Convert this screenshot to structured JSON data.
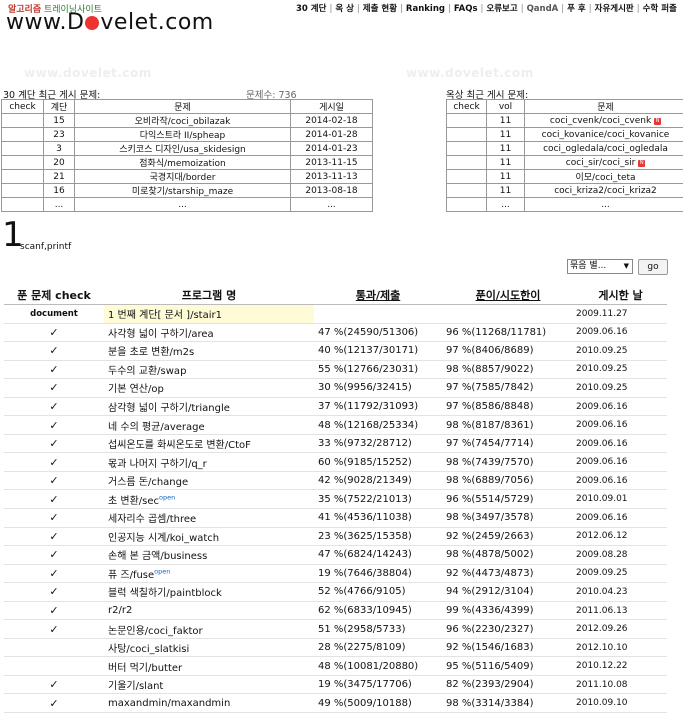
{
  "header": {
    "tagline_a": "알고리즘",
    "tagline_b": " 트레이닝사이트",
    "logo_a": "www.D",
    "logo_b": "velet.com"
  },
  "topnav": [
    "30 계단",
    "옥 상",
    "제출 현황",
    "Ranking",
    "FAQs",
    "오류보고",
    "QandA",
    "푸 후",
    "자유게시판",
    "수학 퍼즐"
  ],
  "watermark": "www.dovelet.com",
  "left_panel": {
    "title": "30 계단 최근 게시 문제:",
    "count_label": "문제수: 736",
    "headers": [
      "check",
      "계단",
      "문제",
      "게시일"
    ],
    "rows": [
      [
        "",
        "15",
        "오비라작/coci_obilazak",
        "2014-02-18"
      ],
      [
        "",
        "23",
        "다익스트라 II/spheap",
        "2014-01-28"
      ],
      [
        "",
        "3",
        "스키코스 디자인/usa_skidesign",
        "2014-01-23"
      ],
      [
        "",
        "20",
        "점화식/memoization",
        "2013-11-15"
      ],
      [
        "",
        "21",
        "국경지대/border",
        "2013-11-13"
      ],
      [
        "",
        "16",
        "미로찾기/starship_maze",
        "2013-08-18"
      ],
      [
        "",
        "...",
        "...",
        "..."
      ]
    ]
  },
  "right_panel": {
    "title": "옥상 최근 게시 문제:",
    "headers": [
      "check",
      "vol",
      "문제"
    ],
    "rows": [
      [
        "",
        "11",
        "coci_cvenk/coci_cvenk"
      ],
      [
        "",
        "11",
        "coci_kovanice/coci_kovanice"
      ],
      [
        "",
        "11",
        "coci_ogledala/coci_ogledala"
      ],
      [
        "",
        "11",
        "coci_sir/coci_sir"
      ],
      [
        "",
        "11",
        "이모/coci_teta"
      ],
      [
        "",
        "11",
        "coci_kriza2/coci_kriza2"
      ],
      [
        "",
        "...",
        "..."
      ]
    ]
  },
  "stair": {
    "number": "1",
    "subtitle": "scanf,printf"
  },
  "sort": {
    "selected": "묶음 별...",
    "go_label": "go"
  },
  "main_table": {
    "headers": [
      "푼 문제 check",
      "프로그램 명",
      "통과/제출",
      "푼이/시도한이",
      "게시한 날"
    ],
    "rows": [
      {
        "check": "document",
        "name": "1 번째 계단[ 문서 ]/stair1",
        "pass": "",
        "solved": "",
        "date": "2009.11.27"
      },
      {
        "check": "✓",
        "name": "사각형 넓이 구하기/area",
        "pass": "47 %(24590/51306)",
        "solved": "96 %(11268/11781)",
        "date": "2009.06.16"
      },
      {
        "check": "✓",
        "name": "분을 초로 변환/m2s",
        "pass": "40 %(12137/30171)",
        "solved": "97 %(8406/8689)",
        "date": "2010.09.25"
      },
      {
        "check": "✓",
        "name": "두수의 교환/swap",
        "pass": "55 %(12766/23031)",
        "solved": "98 %(8857/9022)",
        "date": "2010.09.25"
      },
      {
        "check": "✓",
        "name": "기본 연산/op",
        "pass": "30 %(9956/32415)",
        "solved": "97 %(7585/7842)",
        "date": "2010.09.25"
      },
      {
        "check": "✓",
        "name": "삼각형 넓이 구하기/triangle",
        "pass": "37 %(11792/31093)",
        "solved": "97 %(8586/8848)",
        "date": "2009.06.16"
      },
      {
        "check": "✓",
        "name": "네 수의 평균/average",
        "pass": "48 %(12168/25334)",
        "solved": "98 %(8187/8361)",
        "date": "2009.06.16"
      },
      {
        "check": "✓",
        "name": "섭씨온도를 화씨온도로 변환/CtoF",
        "pass": "33 %(9732/28712)",
        "solved": "97 %(7454/7714)",
        "date": "2009.06.16"
      },
      {
        "check": "✓",
        "name": "몫과 나머지 구하기/q_r",
        "pass": "60 %(9185/15252)",
        "solved": "98 %(7439/7570)",
        "date": "2009.06.16"
      },
      {
        "check": "✓",
        "name": "거스름 돈/change",
        "pass": "42 %(9028/21349)",
        "solved": "98 %(6889/7056)",
        "date": "2009.06.16"
      },
      {
        "check": "✓",
        "name": "초 변환/sec",
        "open": "open",
        "pass": "35 %(7522/21013)",
        "solved": "96 %(5514/5729)",
        "date": "2010.09.01"
      },
      {
        "check": "✓",
        "name": "세자리수 곱셈/three",
        "pass": "41 %(4536/11038)",
        "solved": "98 %(3497/3578)",
        "date": "2009.06.16"
      },
      {
        "check": "✓",
        "name": "인공지능 시계/koi_watch",
        "pass": "23 %(3625/15358)",
        "solved": "92 %(2459/2663)",
        "date": "2012.06.12"
      },
      {
        "check": "✓",
        "name": "손해 본 금액/business",
        "pass": "47 %(6824/14243)",
        "solved": "98 %(4878/5002)",
        "date": "2009.08.28"
      },
      {
        "check": "✓",
        "name": "퓨 즈/fuse",
        "open": "open",
        "pass": "19 %(7646/38804)",
        "solved": "92 %(4473/4873)",
        "date": "2009.09.25"
      },
      {
        "check": "✓",
        "name": "블럭 색칠하기/paintblock",
        "pass": "52 %(4766/9105)",
        "solved": "94 %(2912/3104)",
        "date": "2010.04.23"
      },
      {
        "check": "✓",
        "name": "r2/r2",
        "pass": "62 %(6833/10945)",
        "solved": "99 %(4336/4399)",
        "date": "2011.06.13"
      },
      {
        "check": "✓",
        "name": "논문인용/coci_faktor",
        "pass": "51 %(2958/5733)",
        "solved": "96 %(2230/2327)",
        "date": "2012.09.26"
      },
      {
        "check": "",
        "name": "사탕/coci_slatkisi",
        "pass": "28 %(2275/8109)",
        "solved": "92 %(1546/1683)",
        "date": "2012.10.10"
      },
      {
        "check": "",
        "name": "버터 먹기/butter",
        "pass": "48 %(10081/20880)",
        "solved": "95 %(5116/5409)",
        "date": "2010.12.22"
      },
      {
        "check": "✓",
        "name": "기울기/slant",
        "pass": "19 %(3475/17706)",
        "solved": "82 %(2393/2904)",
        "date": "2011.10.08"
      },
      {
        "check": "✓",
        "name": "maxandmin/maxandmin",
        "pass": "49 %(5009/10188)",
        "solved": "98 %(3314/3384)",
        "date": "2010.09.10"
      }
    ]
  }
}
